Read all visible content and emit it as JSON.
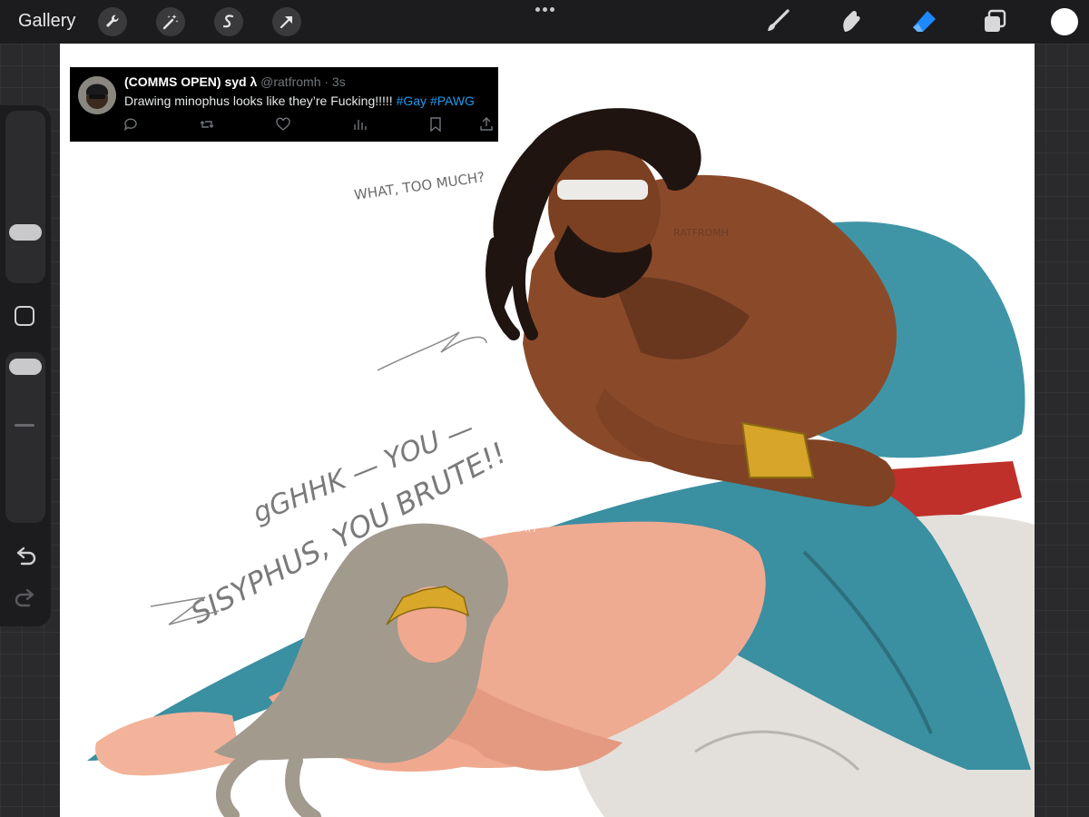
{
  "app": {
    "topbar": {
      "gallery_label": "Gallery",
      "left_tools": [
        "wrench-icon",
        "magic-wand-icon",
        "selection-s-icon",
        "transform-arrow-icon"
      ],
      "right_tools": [
        "brush-icon",
        "smudge-icon",
        "eraser-icon",
        "layers-icon"
      ],
      "active_tool": "eraser-icon",
      "active_color": "#1e88ff",
      "current_color": "#ffffff"
    },
    "sidebar": {
      "brush_size_level": 0.3,
      "opacity_level": 0.45,
      "undo_icon": "undo-icon",
      "redo_icon": "redo-icon"
    }
  },
  "tweet": {
    "name": "(COMMS OPEN) syd λ",
    "handle": "@ratfromh · 3s",
    "text": "Drawing minophus looks like they’re Fucking!!!!! ",
    "hashtags": [
      "#Gay",
      "#PAWG"
    ],
    "actions": [
      "reply-icon",
      "retweet-icon",
      "like-icon",
      "views-icon",
      "bookmark-icon",
      "share-icon"
    ]
  },
  "artwork": {
    "speech_top": "WHAT, TOO MUCH?",
    "speech_mid_1": "gGHHK — YOU —",
    "speech_mid_2": "SISYPHUS, YOU BRUTE!!",
    "watermarks": [
      "RATFROMH",
      "RATFROMH"
    ]
  }
}
